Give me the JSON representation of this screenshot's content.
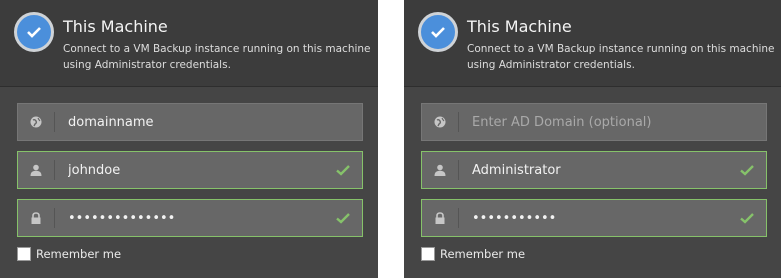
{
  "panels": [
    {
      "title": "This Machine",
      "description": "Connect to a VM Backup instance running on this machine using Administrator credentials.",
      "domain": {
        "value": "domainname",
        "placeholder": "Enter AD Domain (optional)",
        "valid": false
      },
      "username": {
        "value": "johndoe",
        "valid": true
      },
      "password": {
        "value": "••••••••••••••",
        "valid": true
      },
      "remember_label": "Remember me"
    },
    {
      "title": "This Machine",
      "description": "Connect to a VM Backup instance running on this machine using Administrator credentials.",
      "domain": {
        "value": "",
        "placeholder": "Enter AD Domain (optional)",
        "valid": false
      },
      "username": {
        "value": "Administrator",
        "valid": true
      },
      "password": {
        "value": "•••••••••••",
        "valid": true
      },
      "remember_label": "Remember me"
    }
  ],
  "colors": {
    "panel_bg": "#454545",
    "header_bg": "#3c3c3c",
    "accent_blue": "#4b8fdb",
    "valid_green": "#86c26a"
  },
  "icons": {
    "selected": "check-circle-icon",
    "domain": "globe-icon",
    "username": "user-icon",
    "password": "lock-icon",
    "valid": "checkmark-icon"
  }
}
